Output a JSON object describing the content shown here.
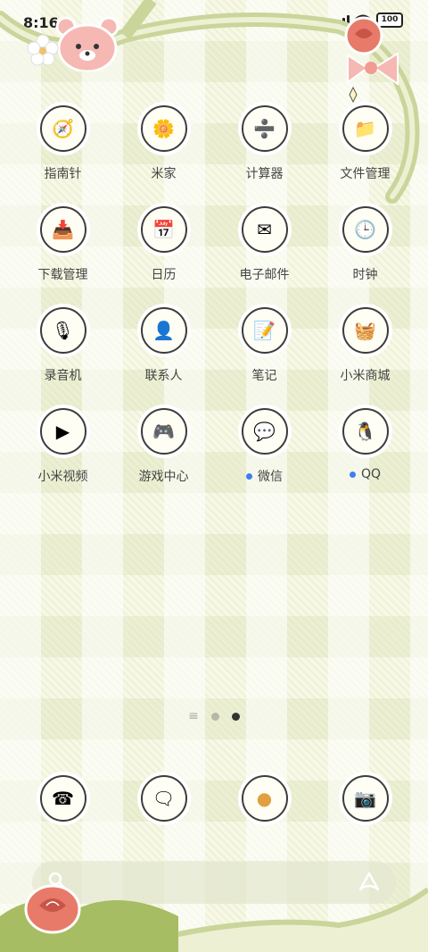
{
  "status_bar": {
    "time": "8:16",
    "battery": "100"
  },
  "apps": [
    {
      "label": "指南针",
      "icon": "compass-icon",
      "glyph": "🧭",
      "has_dot": false
    },
    {
      "label": "米家",
      "icon": "mi-home-icon",
      "glyph": "🌼",
      "has_dot": false
    },
    {
      "label": "计算器",
      "icon": "calculator-icon",
      "glyph": "➗",
      "has_dot": false
    },
    {
      "label": "文件管理",
      "icon": "file-manager-icon",
      "glyph": "📁",
      "has_dot": false
    },
    {
      "label": "下载管理",
      "icon": "download-manager-icon",
      "glyph": "📥",
      "has_dot": false
    },
    {
      "label": "日历",
      "icon": "calendar-icon",
      "glyph": "📅",
      "has_dot": false
    },
    {
      "label": "电子邮件",
      "icon": "email-icon",
      "glyph": "✉",
      "has_dot": false
    },
    {
      "label": "时钟",
      "icon": "clock-icon",
      "glyph": "🕒",
      "has_dot": false
    },
    {
      "label": "录音机",
      "icon": "recorder-icon",
      "glyph": "🎙",
      "has_dot": false
    },
    {
      "label": "联系人",
      "icon": "contacts-icon",
      "glyph": "👤",
      "has_dot": false
    },
    {
      "label": "笔记",
      "icon": "notes-icon",
      "glyph": "📝",
      "has_dot": false
    },
    {
      "label": "小米商城",
      "icon": "mi-store-icon",
      "glyph": "🧺",
      "has_dot": false
    },
    {
      "label": "小米视频",
      "icon": "mi-video-icon",
      "glyph": "▶",
      "has_dot": false
    },
    {
      "label": "游戏中心",
      "icon": "game-center-icon",
      "glyph": "🎮",
      "has_dot": false
    },
    {
      "label": "微信",
      "icon": "wechat-icon",
      "glyph": "💬",
      "has_dot": true
    },
    {
      "label": "QQ",
      "icon": "qq-icon",
      "glyph": "🐧",
      "has_dot": true
    }
  ],
  "page_indicator": {
    "pages": 2,
    "current": 2
  },
  "dock": [
    {
      "icon": "phone-icon",
      "glyph": "☎"
    },
    {
      "icon": "messages-icon",
      "glyph": "🗨"
    },
    {
      "icon": "browser-icon",
      "glyph": "●"
    },
    {
      "icon": "camera-icon",
      "glyph": "📷"
    }
  ]
}
